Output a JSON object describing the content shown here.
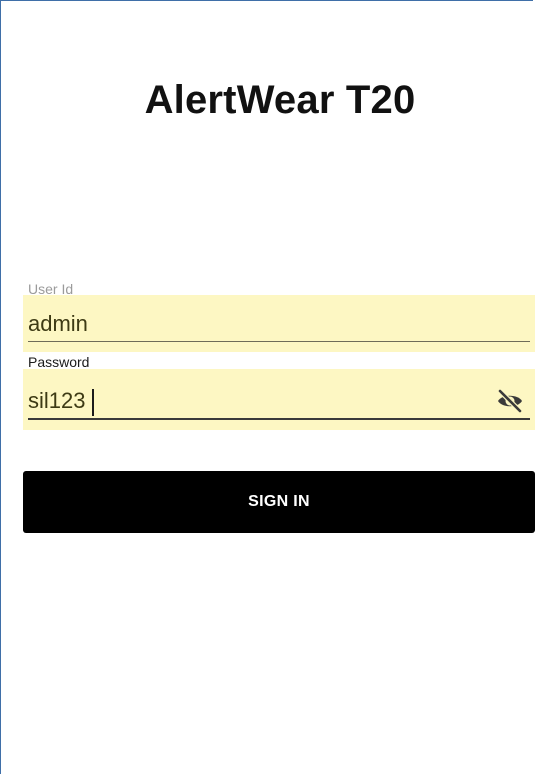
{
  "app": {
    "title": "AlertWear T20"
  },
  "form": {
    "user_id": {
      "label": "User Id",
      "value": "admin"
    },
    "password": {
      "label": "Password",
      "value": "sil123",
      "visibility_icon": "eye-off-icon"
    },
    "sign_in_label": "SIGN IN"
  },
  "colors": {
    "field_background": "#fdf7c3",
    "button_background": "#000000",
    "button_text": "#ffffff",
    "frame_border": "#3f6fa8"
  }
}
